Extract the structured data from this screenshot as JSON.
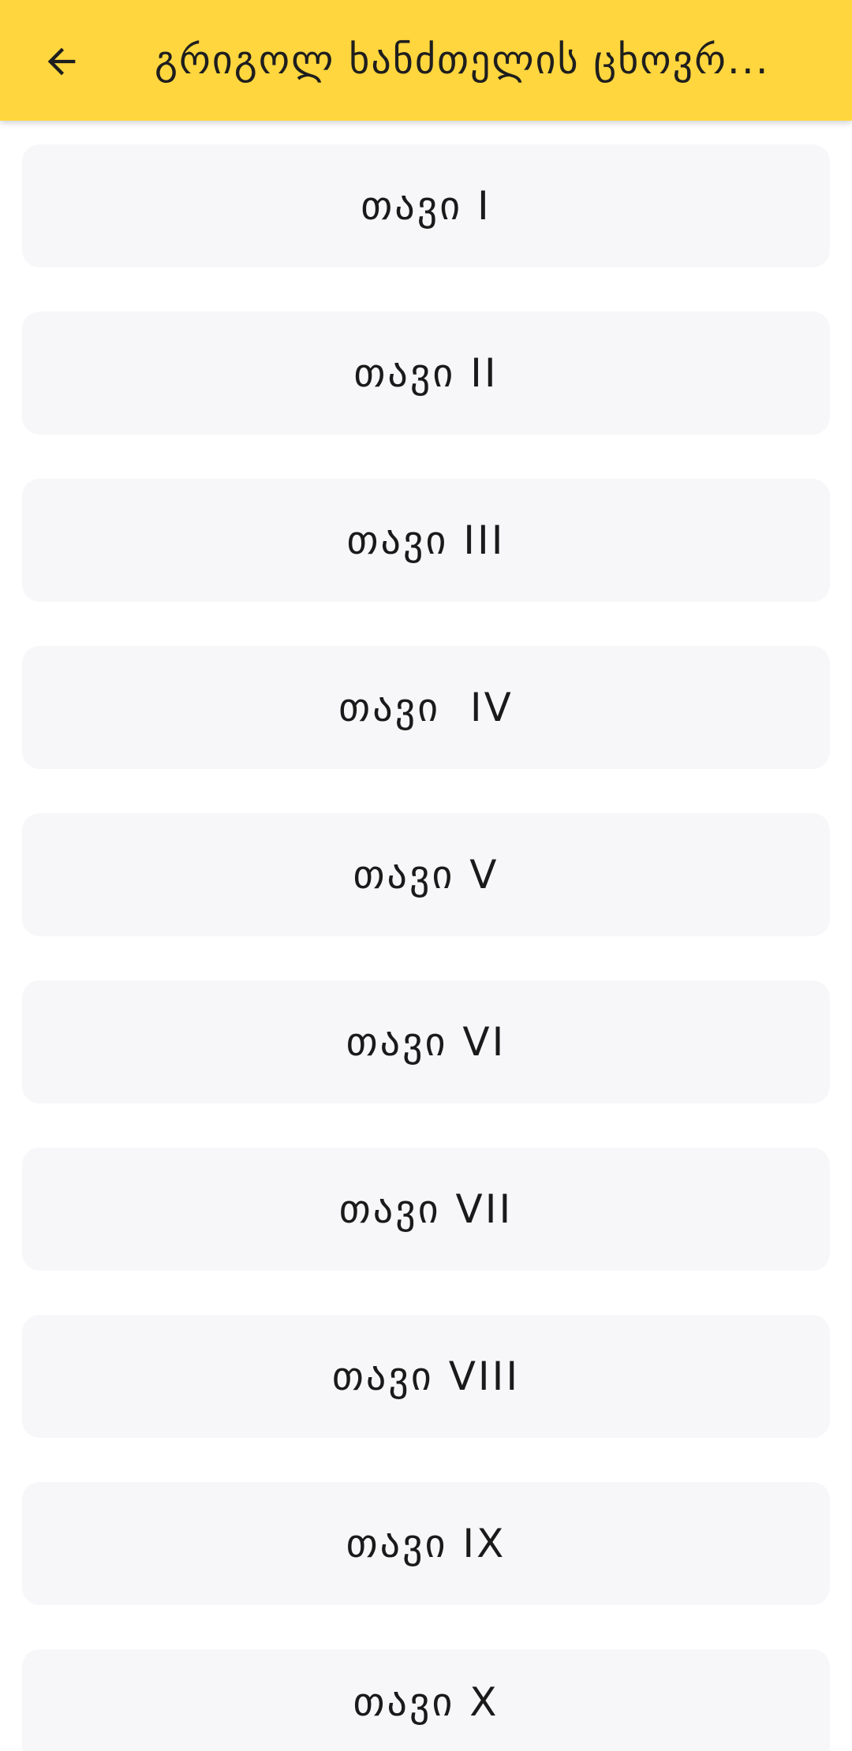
{
  "app_bar": {
    "title": "გრიგოლ ხანძთელის ცხოვრ...",
    "back_icon": "arrow-left-icon",
    "background_color": "#FFD63D"
  },
  "chapters": [
    {
      "label": "თავი I"
    },
    {
      "label": "თავი II"
    },
    {
      "label": "თავი III"
    },
    {
      "label": "თავი  IV"
    },
    {
      "label": "თავი V"
    },
    {
      "label": "თავი VI"
    },
    {
      "label": "თავი VII"
    },
    {
      "label": "თავი VIII"
    },
    {
      "label": "თავი IX"
    },
    {
      "label": "თავი X"
    }
  ],
  "colors": {
    "card_background": "#F7F7F9",
    "text": "#1a1a1a"
  }
}
